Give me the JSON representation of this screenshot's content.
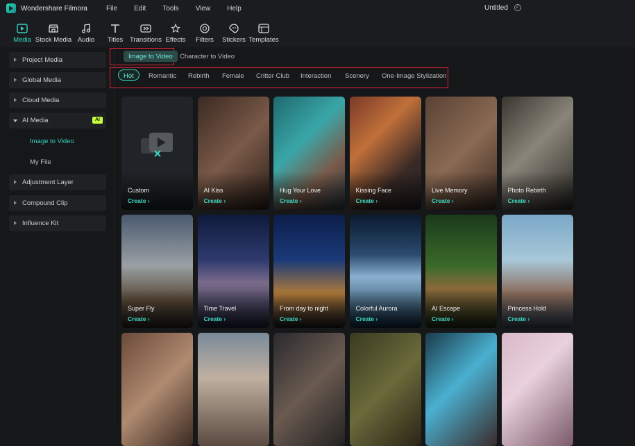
{
  "titlebar": {
    "app_name": "Wondershare Filmora",
    "menu": [
      "File",
      "Edit",
      "Tools",
      "View",
      "Help"
    ],
    "doc_title": "Untitled"
  },
  "toolbar": {
    "items": [
      {
        "label": "Media",
        "icon": "media-icon",
        "active": true
      },
      {
        "label": "Stock Media",
        "icon": "stock-media-icon"
      },
      {
        "label": "Audio",
        "icon": "audio-icon"
      },
      {
        "label": "Titles",
        "icon": "titles-icon"
      },
      {
        "label": "Transitions",
        "icon": "transitions-icon"
      },
      {
        "label": "Effects",
        "icon": "effects-icon"
      },
      {
        "label": "Filters",
        "icon": "filters-icon"
      },
      {
        "label": "Stickers",
        "icon": "stickers-icon"
      },
      {
        "label": "Templates",
        "icon": "templates-icon"
      }
    ]
  },
  "sidebar": {
    "items": [
      {
        "label": "Project Media"
      },
      {
        "label": "Global Media"
      },
      {
        "label": "Cloud Media"
      },
      {
        "label": "AI Media",
        "badge": "AI",
        "open": true
      },
      {
        "label": "Adjustment Layer"
      },
      {
        "label": "Compound Clip"
      },
      {
        "label": "Influence Kit"
      }
    ],
    "sub_items": [
      {
        "label": "Image to Video",
        "active": true
      },
      {
        "label": "My File"
      }
    ]
  },
  "tabs": [
    {
      "label": "Image to Video",
      "active": true
    },
    {
      "label": "Character to Video"
    }
  ],
  "categories": [
    "Hot",
    "Romantic",
    "Rebirth",
    "Female",
    "Critter Club",
    "Interaction",
    "Scenery",
    "One-Image Stylization"
  ],
  "create_label": "Create",
  "cards": [
    {
      "name": "Custom",
      "bg": "#202327"
    },
    {
      "name": "AI Kiss",
      "bg": "linear-gradient(135deg,#3a2a22,#7a5a48 50%,#2b1e18)"
    },
    {
      "name": "Hug Your Love",
      "bg": "linear-gradient(135deg,#1e6a6e,#3aa6a8 40%,#7a5a4a 70%,#2a3a44)"
    },
    {
      "name": "Kissing Face",
      "bg": "linear-gradient(135deg,#7a3a28,#c0703a 35%,#3a2a26 70%,#222)"
    },
    {
      "name": "Live Memory",
      "bg": "linear-gradient(135deg,#5a4236,#8a6a52 50%,#3a2a22)"
    },
    {
      "name": "Photo Rebirth",
      "bg": "linear-gradient(135deg,#3a3630,#8a857a 45%,#2a2824)"
    },
    {
      "name": "Super Fly",
      "bg": "linear-gradient(180deg,#4a5a6e,#9aa0a4 45%,#5a4a3a 75%,#2a2420)"
    },
    {
      "name": "Time Travel",
      "bg": "linear-gradient(180deg,#0e1a3a,#2e3a6e 40%,#7a6a8a 60%,#1a2238)"
    },
    {
      "name": "From day to night",
      "bg": "linear-gradient(180deg,#0c1e4a,#1a3a7a 40%,#b07a3a 70%,#1a1a22)"
    },
    {
      "name": "Colorful Aurora",
      "bg": "linear-gradient(180deg,#0a1a2e,#2a4a6e 35%,#8ab0d0 55%,#0e2a3e)"
    },
    {
      "name": "AI Escape",
      "bg": "linear-gradient(180deg,#1a3a1a,#3a6a2a 45%,#8a6a3a 65%,#1a2a14)"
    },
    {
      "name": "Princess Hold",
      "bg": "linear-gradient(180deg,#7aa8c8,#a8c8d8 40%,#8a6a5a 70%,#3a4a5a)"
    },
    {
      "name": "",
      "bg": "linear-gradient(135deg,#6a4a3a,#b08a70 50%,#3a2a22)"
    },
    {
      "name": "",
      "bg": "linear-gradient(180deg,#7a8a9a,#c0b0a0 40%,#5a4a40)"
    },
    {
      "name": "",
      "bg": "linear-gradient(135deg,#2a2a2e,#6a5a50 50%,#222)"
    },
    {
      "name": "",
      "bg": "linear-gradient(135deg,#3a3a22,#6a6a3a 50%,#2a2418)"
    },
    {
      "name": "",
      "bg": "linear-gradient(135deg,#1a3a4a,#4ab0d0 45%,#3a2a2a)"
    },
    {
      "name": "",
      "bg": "linear-gradient(135deg,#d8b8c8,#e8d0dc 40%,#7a5a6a)"
    }
  ]
}
